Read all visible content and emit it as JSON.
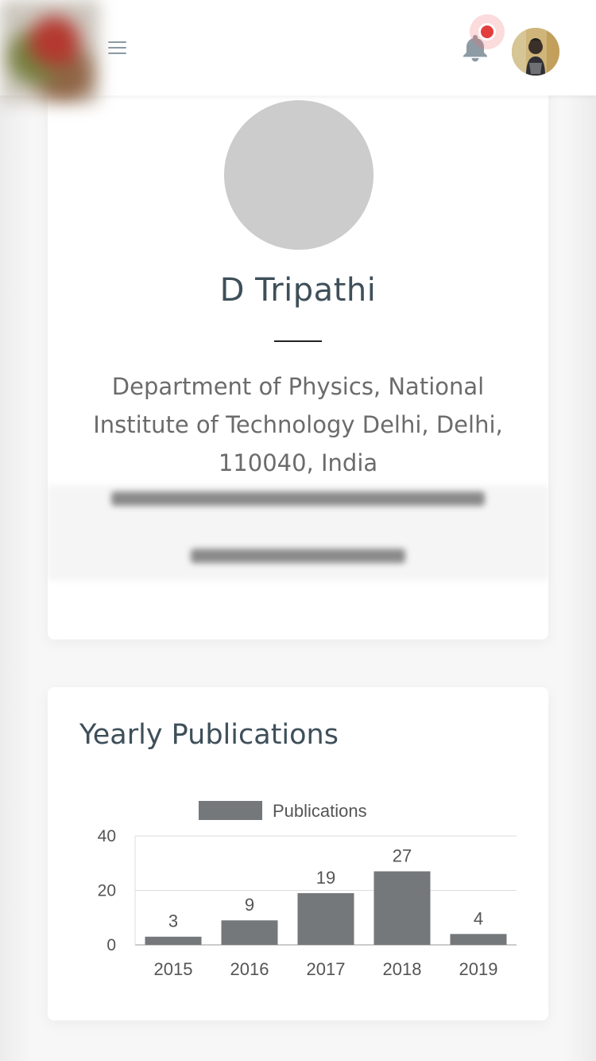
{
  "header": {
    "menu_icon": "hamburger-icon",
    "notification_icon": "bell-icon",
    "notification_color": "#e33d3d"
  },
  "profile": {
    "name": "D Tripathi",
    "affiliation": "Department of Physics, National Institute of Technology Delhi, Delhi, 110040, India"
  },
  "publications": {
    "title": "Yearly Publications"
  },
  "chart_data": {
    "type": "bar",
    "categories": [
      "2015",
      "2016",
      "2017",
      "2018",
      "2019"
    ],
    "series": [
      {
        "name": "Publications",
        "values": [
          3,
          9,
          19,
          27,
          4
        ],
        "color": "#75787b"
      }
    ],
    "yticks": [
      "0",
      "20",
      "40"
    ],
    "ylim": [
      0,
      40
    ],
    "grid": true,
    "legend": "top",
    "data_labels": true
  }
}
